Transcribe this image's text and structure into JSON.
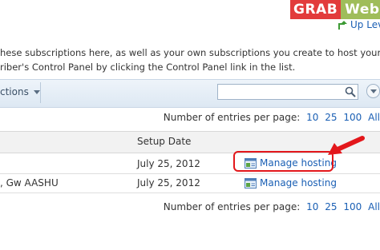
{
  "watermark": {
    "part1": "GRAB",
    "part2": "Web"
  },
  "nav": {
    "up_level": "Up Lev"
  },
  "description": {
    "line1": "hese subscriptions here, as well as your own subscriptions you create to host your websites",
    "line2": "riber's Control Panel by clicking the Control Panel link in the list."
  },
  "toolbar": {
    "actions_label": "ctions",
    "search_placeholder": ""
  },
  "pagination": {
    "label": "Number of entries per page:",
    "options": [
      "10",
      "25",
      "100",
      "All"
    ]
  },
  "table": {
    "columns": {
      "setup_date": "Setup Date"
    },
    "rows": [
      {
        "name": "",
        "setup_date": "July 25, 2012",
        "action": "Manage hosting",
        "highlighted": true
      },
      {
        "name": ", Gw AASHU",
        "setup_date": "July 25, 2012",
        "action": "Manage hosting",
        "highlighted": false
      }
    ]
  },
  "colors": {
    "link": "#1a5fb4",
    "highlight": "#e3171b",
    "logo_red": "#e23b3b",
    "logo_green": "#9fbd5a"
  },
  "icons": {
    "search": "magnifier-icon",
    "collapse": "chevron-down-icon",
    "manage_hosting": "hosting-panel-icon",
    "up": "up-arrow-icon"
  }
}
